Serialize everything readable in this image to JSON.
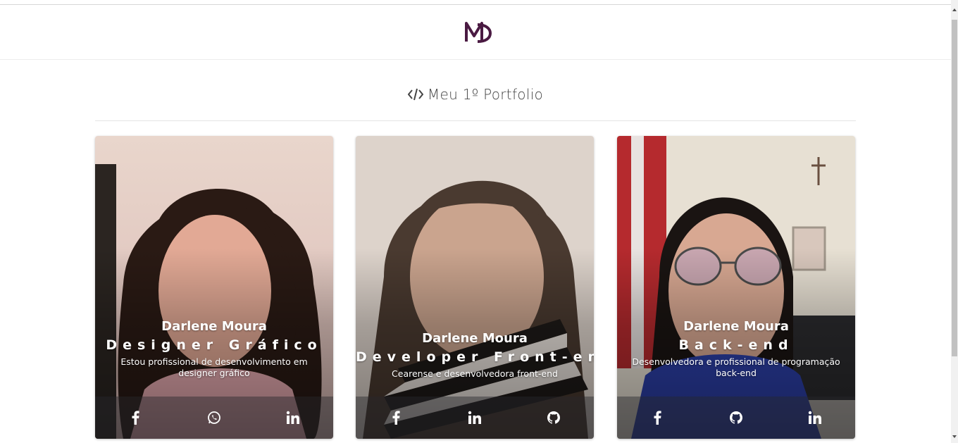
{
  "page": {
    "title_icon": "code-icon",
    "title": "Meu 1º Portfolio"
  },
  "header": {
    "logo_text": "MD",
    "logo_color": "#4a1a42"
  },
  "cards": [
    {
      "name": "Darlene Moura",
      "role": "Designer Gráfico",
      "description": "Estou profissional de desenvolvimento em designer gráfico",
      "social": [
        "facebook-icon",
        "whatsapp-icon",
        "linkedin-icon"
      ]
    },
    {
      "name": "Darlene Moura",
      "role": "Developer Front-end",
      "description": "Cearense e desenvolvedora front-end",
      "social": [
        "facebook-icon",
        "linkedin-icon",
        "github-icon"
      ]
    },
    {
      "name": "Darlene Moura",
      "role": "Back-end",
      "description": "Desenvolvedora e profissional de programação back-end",
      "social": [
        "facebook-icon",
        "github-icon",
        "linkedin-icon"
      ]
    }
  ]
}
